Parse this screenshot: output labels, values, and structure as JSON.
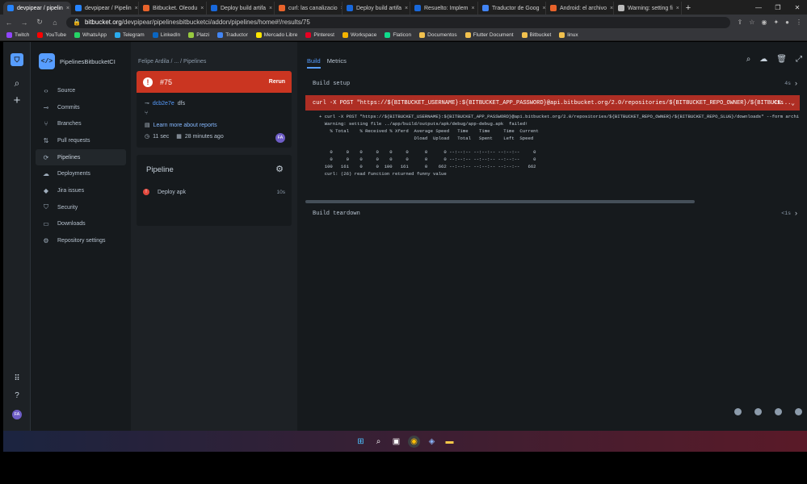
{
  "browser": {
    "tabs": [
      {
        "title": "devpipear / pipelin",
        "color": "#2684ff",
        "active": true
      },
      {
        "title": "devpipear / Pipelin",
        "color": "#2684ff"
      },
      {
        "title": "Bitbucket. Oleodu",
        "color": "#e8632b"
      },
      {
        "title": "Deploy build artifa",
        "color": "#1868db"
      },
      {
        "title": "curl: las canalizacio",
        "color": "#e8632b"
      },
      {
        "title": "Deploy build artifa",
        "color": "#1868db"
      },
      {
        "title": "Resuelto: Implem",
        "color": "#1868db"
      },
      {
        "title": "Traductor de Goog",
        "color": "#4285f4"
      },
      {
        "title": "Android: el archivo",
        "color": "#e8632b"
      },
      {
        "title": "Warning: setting fi",
        "color": "#bbbbbb"
      }
    ],
    "url_host": "bitbucket.org",
    "url_path": "/devpipear/pipelinesbitbucketci/addon/pipelines/home#!/results/75",
    "bookmarks": [
      {
        "label": "Twitch",
        "color": "#9146ff"
      },
      {
        "label": "YouTube",
        "color": "#ff0000"
      },
      {
        "label": "WhatsApp",
        "color": "#25d366"
      },
      {
        "label": "Telegram",
        "color": "#2aabee"
      },
      {
        "label": "LinkedIn",
        "color": "#0a66c2"
      },
      {
        "label": "Platzi",
        "color": "#98ca3f"
      },
      {
        "label": "Traductor",
        "color": "#4285f4"
      },
      {
        "label": "Mercado Libre",
        "color": "#ffe600"
      },
      {
        "label": "Pinterest",
        "color": "#e60023"
      },
      {
        "label": "Workspace",
        "color": "#f4b400"
      },
      {
        "label": "Flaticon",
        "color": "#0fdc8c"
      },
      {
        "label": "Documentos",
        "color": "#f2c14e"
      },
      {
        "label": "Flutter Document",
        "color": "#f2c14e"
      },
      {
        "label": "Bitbucket",
        "color": "#f2c14e"
      },
      {
        "label": "linux",
        "color": "#f2c14e"
      }
    ]
  },
  "sidebar": {
    "repo_name": "PipelinesBitbucketCI",
    "items": [
      {
        "label": "Source",
        "icon": "code-icon",
        "glyph": "‹›"
      },
      {
        "label": "Commits",
        "icon": "commit-icon",
        "glyph": "⊸"
      },
      {
        "label": "Branches",
        "icon": "branch-icon",
        "glyph": "⑂"
      },
      {
        "label": "Pull requests",
        "icon": "pull-request-icon",
        "glyph": "⇅"
      },
      {
        "label": "Pipelines",
        "icon": "pipelines-icon",
        "glyph": "⟳",
        "active": true
      },
      {
        "label": "Deployments",
        "icon": "cloud-icon",
        "glyph": "☁"
      },
      {
        "label": "Jira issues",
        "icon": "jira-icon",
        "glyph": "◆"
      },
      {
        "label": "Security",
        "icon": "shield-icon",
        "glyph": "⛉"
      },
      {
        "label": "Downloads",
        "icon": "file-icon",
        "glyph": "▭"
      },
      {
        "label": "Repository settings",
        "icon": "gear-icon",
        "glyph": "⚙"
      }
    ]
  },
  "main": {
    "breadcrumb": "Felipe Ardila  /  ...  /  Pipelines",
    "build_number": "#75",
    "rerun_label": "Rerun",
    "commit_hash": "dcb2e7e",
    "commit_message": "dfs",
    "reports_link": "Learn more about reports",
    "duration": "11 sec",
    "ago": "28 minutes ago",
    "user_initials": "FA",
    "pipeline_title": "Pipeline",
    "step_name": "Deploy apk",
    "step_time": "10s"
  },
  "log": {
    "tabs": [
      "Build",
      "Metrics"
    ],
    "build_setup": "Build setup",
    "build_setup_time": "4s",
    "command": "curl -X POST \"https://${BITBUCKET_USERNAME}:${BITBUCKET_APP_PASSWORD}@api.bitbucket.org/2.0/repositories/${BITBUCKET_REPO_OWNER}/${BITBUCK...",
    "command_time": "<1s",
    "output": [
      "+ curl -X POST \"https://${BITBUCKET_USERNAME}:${BITBUCKET_APP_PASSWORD}@api.bitbucket.org/2.0/repositories/${BITBUCKET_REPO_OWNER}/${BITBUCKET_REPO_SLUG}/downloads\" --form archi",
      "  Warning: setting file ../app/build/outputs/apk/debug/app-debug.apk  failed!",
      "    % Total    % Received % Xferd  Average Speed   Time    Time     Time  Current",
      "                                   Dload  Upload   Total   Spent    Left  Speed",
      "",
      "    0     0    0     0    0     0      0      0 --:--:-- --:--:-- --:--:--     0",
      "    0     0    0     0    0     0      0      0 --:--:-- --:--:-- --:--:--     0",
      "  100   161    0     0  100   161      0    662 --:--:-- --:--:-- --:--:--   662",
      "  curl: (26) read function returned funny value"
    ],
    "build_teardown": "Build teardown",
    "build_teardown_time": "<1s"
  }
}
